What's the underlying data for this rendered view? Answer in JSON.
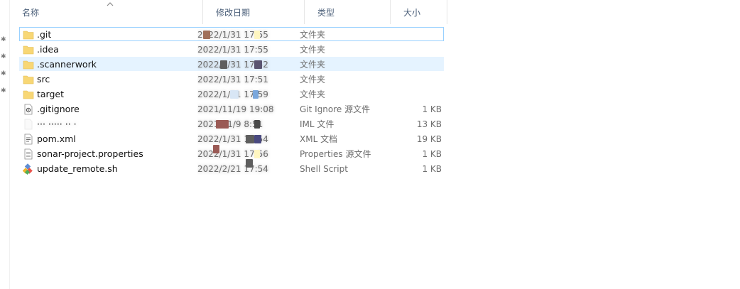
{
  "columns": {
    "name": "名称",
    "date": "修改日期",
    "type": "类型",
    "size": "大小"
  },
  "files": [
    {
      "name": ".git",
      "date": "2022/1/31 17:55",
      "type": "文件夹",
      "size": "",
      "icon": "folder-icon"
    },
    {
      "name": ".idea",
      "date": "2022/1/31 17:55",
      "type": "文件夹",
      "size": "",
      "icon": "folder-icon"
    },
    {
      "name": ".scannerwork",
      "date": "2022/1/31 17:52",
      "type": "文件夹",
      "size": "",
      "icon": "folder-icon"
    },
    {
      "name": "src",
      "date": "2022/1/31 17:51",
      "type": "文件夹",
      "size": "",
      "icon": "folder-icon"
    },
    {
      "name": "target",
      "date": "2022/1/31 17:59",
      "type": "文件夹",
      "size": "",
      "icon": "folder-icon"
    },
    {
      "name": ".gitignore",
      "date": "2021/11/19 19:08",
      "type": "Git Ignore 源文件",
      "size": "1 KB",
      "icon": "settings-file-icon"
    },
    {
      "name": "··· ····· ·· ·",
      "date": "2021/11/9 8:51",
      "type": "IML 文件",
      "size": "13 KB",
      "icon": "blank-file-icon"
    },
    {
      "name": "pom.xml",
      "date": "2022/1/31 17:54",
      "type": "XML 文档",
      "size": "19 KB",
      "icon": "xml-file-icon"
    },
    {
      "name": "sonar-project.properties",
      "date": "2022/1/31 17:56",
      "type": "Properties 源文件",
      "size": "1 KB",
      "icon": "text-file-icon"
    },
    {
      "name": "update_remote.sh",
      "date": "2022/2/21 17:54",
      "type": "Shell Script",
      "size": "1 KB",
      "icon": "git-script-icon"
    }
  ],
  "colors": {
    "selected_row": "#e5f3ff",
    "focus_border": "#99d1ff",
    "folder": "#f8d775",
    "header_text": "#4c607a"
  }
}
